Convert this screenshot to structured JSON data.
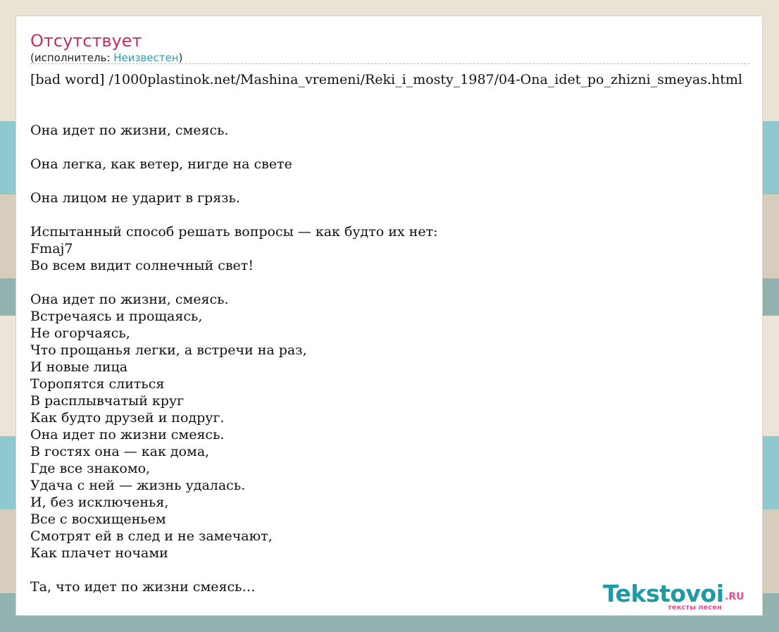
{
  "song": {
    "title": "Отсутствует",
    "artist_prefix": "(исполнитель: ",
    "artist_name": "Неизвестен",
    "artist_suffix": ")"
  },
  "source_line": "[bad word] /1000plastinok.net/Mashina_vremeni/Reki_i_mosty_1987/04-Ona_idet_po_zhizni_smeyas.html",
  "lyrics": [
    "",
    "Она идет по жизни, смеясь.",
    "",
    "Она легка, как ветер, нигде на свете",
    "",
    "Она лицом не ударит в грязь.",
    "",
    "Испытанный способ решать вопросы — как будто их нет:",
    "Fmaj7",
    "Во всем видит солнечный свет!",
    "",
    "Она идет по жизни, смеясь.",
    "Встречаясь и прощаясь,",
    "Не огорчаясь,",
    "Что прощанья легки, а встречи на раз,",
    "И новые лица",
    "Торопятся слиться",
    "В расплывчатый круг",
    "Как будто друзей и подруг.",
    "Она идет по жизни смеясь.",
    "В гостях она — как дома,",
    "Где все знакомо,",
    "Удача с ней — жизнь удалась.",
    "И, без исключенья,",
    "Все с восхищеньем",
    "Смотрят ей в след и не замечают,",
    "Как плачет ночами",
    "",
    "Та, что идет по жизни смеясь…"
  ],
  "logo": {
    "name": "Tekstovoi",
    "tld": ".RU",
    "tagline": "тексты песен"
  }
}
